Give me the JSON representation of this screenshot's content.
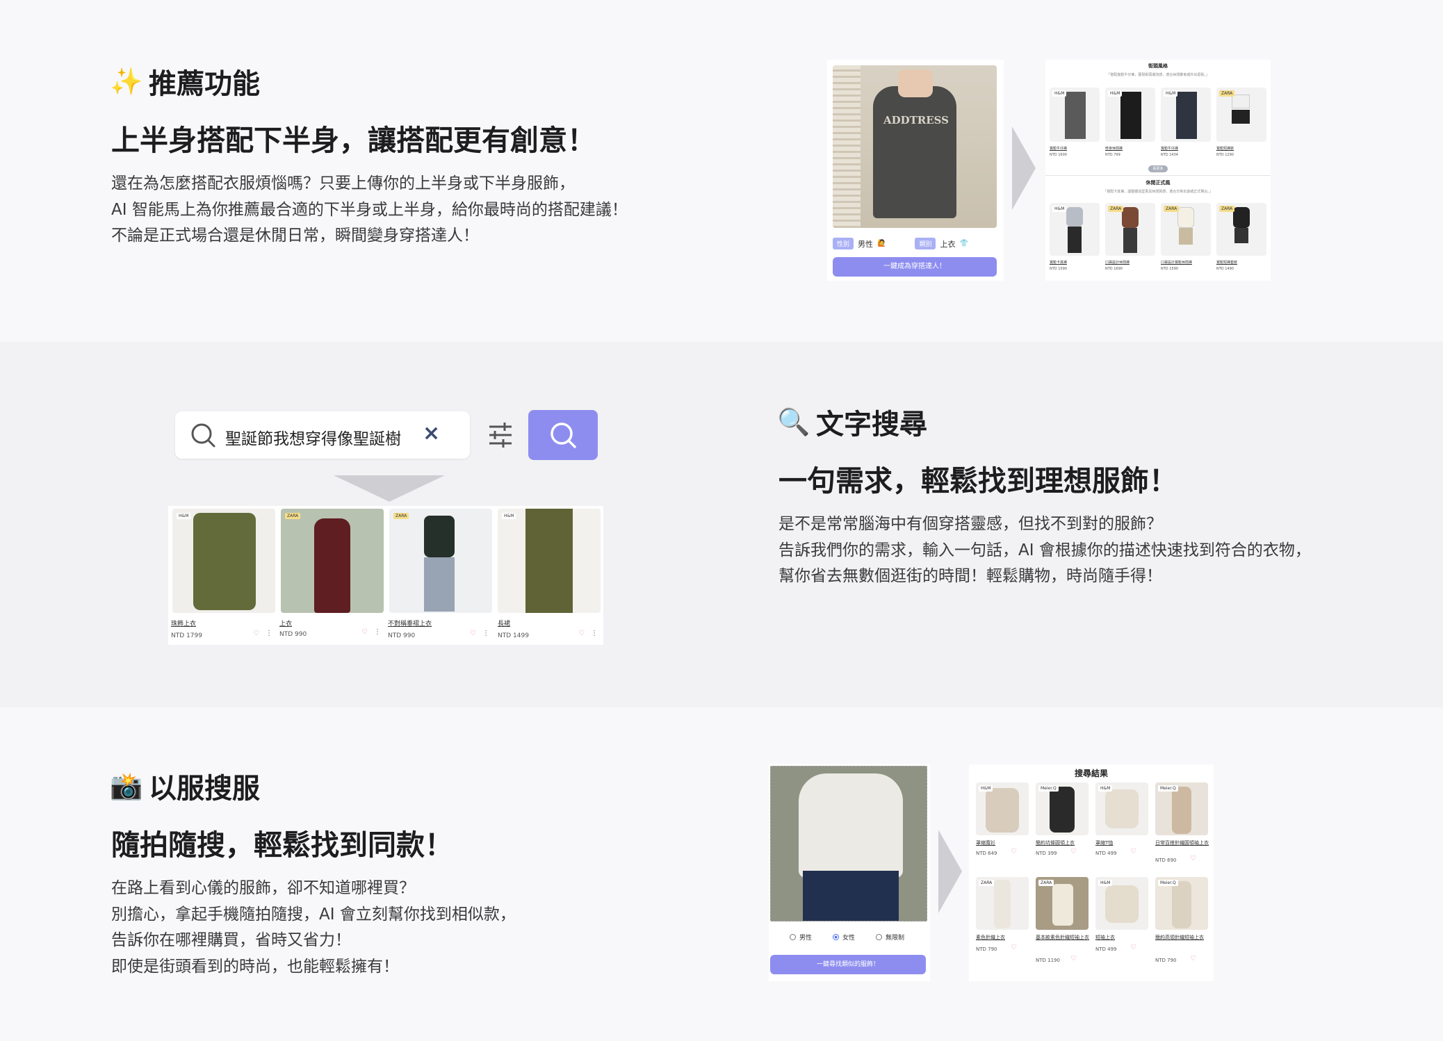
{
  "colors": {
    "accent": "#8d8df0",
    "heart": "#e08aa0",
    "bg_alt": "#f2f2f4"
  },
  "sec1": {
    "emoji": "✨",
    "title": "推薦功能",
    "headline": "上半身搭配下半身，讓搭配更有創意！",
    "lines": [
      "還在為怎麼搭配衣服煩惱嗎？只要上傳你的上半身或下半身服飾，",
      "AI 智能馬上為你推薦最合適的下半身或上半身，給你最時尚的搭配建議！",
      "不論是正式場合還是休閒日常，瞬間變身穿搭達人！"
    ],
    "upload": {
      "shirt_text": "ADDTRESS",
      "tag_gender": "性別",
      "gender_value": "男性",
      "gender_icon": "🙋",
      "tag_category": "類別",
      "category_value": "上衣",
      "category_icon": "👕",
      "button": "一鍵成為穿搭達人！"
    },
    "results": {
      "title_top": "街頭風格",
      "sub_top": "「搭配寬鬆牛仔褲，展現街頭潮流感，適合休閒聚會或外出逛街。」",
      "top_items": [
        {
          "brand": "H&M",
          "name": "寬鬆牛仔褲",
          "price": "NTD 1600"
        },
        {
          "brand": "H&M",
          "name": "修身休閒褲",
          "price": "NTD 799"
        },
        {
          "brand": "H&M",
          "name": "寬鬆牛仔褲",
          "price": "NTD 1434"
        },
        {
          "brand": "ZARA",
          "name": "寬鬆短褲裝",
          "price": "NTD 1290"
        }
      ],
      "more": "看更多",
      "title_bottom": "休閒正式風",
      "sub_bottom": "「搭配卡其褲，讓整體造型更具休閒質感，適合日常出遊或正式場合。」",
      "bottom_items": [
        {
          "brand": "H&M",
          "name": "寬鬆卡其褲",
          "price": "NTD 1590"
        },
        {
          "brand": "ZARA",
          "name": "口袋設計休閒褲",
          "price": "NTD 1690"
        },
        {
          "brand": "ZARA",
          "name": "口袋設計寬鬆休閒褲",
          "price": "NTD 1590"
        },
        {
          "brand": "ZARA",
          "name": "寬鬆短褲套裝",
          "price": "NTD 1490"
        }
      ]
    }
  },
  "sec2": {
    "emoji": "🔍",
    "title": "文字搜尋",
    "headline": "一句需求，輕鬆找到理想服飾！",
    "lines": [
      "是不是常常腦海中有個穿搭靈感，但找不到對的服飾？",
      "告訴我們你的需求，輸入一句話，AI 會根據你的描述快速找到符合的衣物，",
      "幫你省去無數個逛街的時間！輕鬆購物，時尚隨手得！"
    ],
    "search_value": "聖誕節我想穿得像聖誕樹",
    "clear": "×",
    "products": [
      {
        "brand": "H&M",
        "name": "珠飾上衣",
        "price": "NTD 1799"
      },
      {
        "brand": "ZARA",
        "name": "上衣",
        "price": "NTD 990"
      },
      {
        "brand": "ZARA",
        "name": "不對稱垂褶上衣",
        "price": "NTD 990"
      },
      {
        "brand": "H&M",
        "name": "長裙",
        "price": "NTD 1499"
      }
    ]
  },
  "sec3": {
    "emoji": "📸",
    "title": "以服搜服",
    "headline": "隨拍隨搜，輕鬆找到同款！",
    "lines": [
      "在路上看到心儀的服飾，卻不知道哪裡買？",
      "別擔心，拿起手機隨拍隨搜，AI 會立刻幫你找到相似款，",
      "告訴你在哪裡購買，省時又省力！",
      "即使是街頭看到的時尚，也能輕鬆擁有！"
    ],
    "radio": [
      "男性",
      "女性",
      "無限制"
    ],
    "radio_selected": 1,
    "button": "一鍵尋找類似的服飾！",
    "results_title": "搜尋結果",
    "items": [
      {
        "brand": "H&M",
        "name": "罩縮寬衫",
        "price": "NTD 649"
      },
      {
        "brand": "Meier.Q",
        "name": "簡約坑條圓領上衣",
        "price": "NTD 399"
      },
      {
        "brand": "H&M",
        "name": "罩縮T恤",
        "price": "NTD 499"
      },
      {
        "brand": "Meier.Q",
        "name": "日常百搭針織圓領袖上衣",
        "price": "NTD 690"
      },
      {
        "brand": "ZARA",
        "name": "素色針織上衣",
        "price": "NTD 790"
      },
      {
        "brand": "ZARA",
        "name": "基本款素色針織短袖上衣",
        "price": "NTD 1190"
      },
      {
        "brand": "H&M",
        "name": "短袖上衣",
        "price": "NTD 499"
      },
      {
        "brand": "Meier.Q",
        "name": "簡約高領針織短袖上衣",
        "price": "NTD 790"
      }
    ]
  }
}
